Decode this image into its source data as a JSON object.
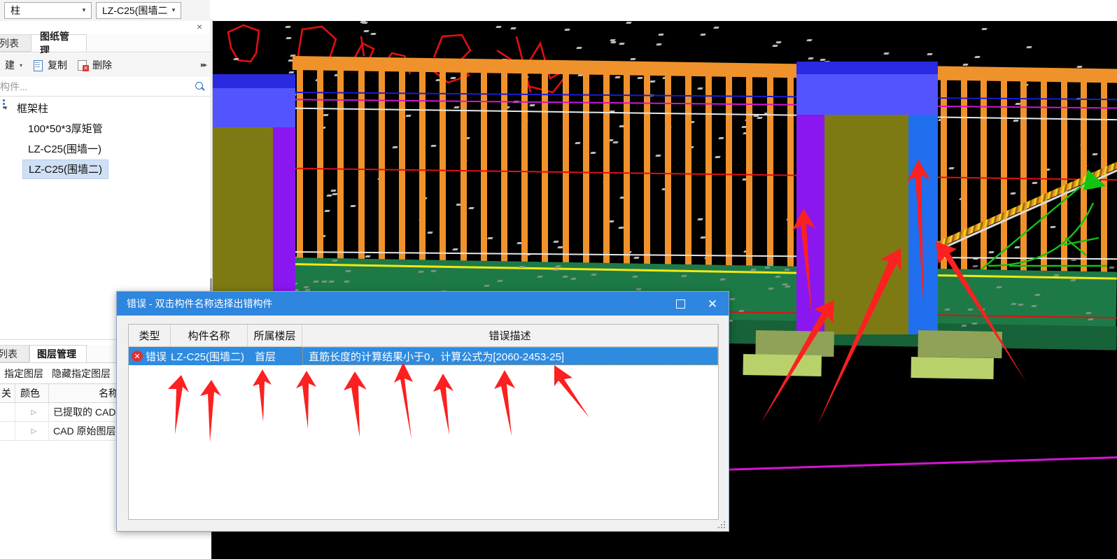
{
  "app": {
    "combos": [
      {
        "name": "category",
        "value": "柱",
        "icon": "chevron-down-icon"
      },
      {
        "name": "member",
        "value": "LZ-C25(围墙二)",
        "icon": "chevron-down-icon"
      }
    ]
  },
  "left_panel": {
    "close_icon": "×",
    "tabs": [
      {
        "label": "列表",
        "active": false
      },
      {
        "label": "图纸管理",
        "active": true
      }
    ],
    "toolbar": {
      "new_label": "建",
      "new_caret": "▾",
      "copy_label": "复制",
      "delete_label": "删除",
      "overflow": "▸▸"
    },
    "search": {
      "placeholder": "构件...",
      "value": "",
      "icon": "search-icon"
    },
    "tree": [
      {
        "label": "框架柱",
        "level": 1,
        "selected": false,
        "expander": "▾"
      },
      {
        "label": "100*50*3厚矩管",
        "level": 2,
        "selected": false
      },
      {
        "label": "LZ-C25(围墙一)",
        "level": 2,
        "selected": false
      },
      {
        "label": "LZ-C25(围墙二)",
        "level": 2,
        "selected": true
      }
    ]
  },
  "layer_panel": {
    "tabs": [
      {
        "label": "列表",
        "active": false
      },
      {
        "label": "图层管理",
        "active": true
      }
    ],
    "buttons": [
      "指定图层",
      "隐藏指定图层"
    ],
    "columns": [
      "关",
      "颜色",
      "名称"
    ],
    "rows": [
      {
        "toggle": "",
        "color": "▷",
        "name": "已提取的 CAD"
      },
      {
        "toggle": "",
        "color": "▷",
        "name": "CAD 原始图层"
      }
    ]
  },
  "dialog": {
    "title": "错误 - 双击构件名称选择出错构件",
    "title_bar_color": "#2e86de",
    "buttons": [
      {
        "name": "maximize",
        "icon": "maximize-icon"
      },
      {
        "name": "close",
        "icon": "close-icon"
      }
    ],
    "columns": [
      "类型",
      "构件名称",
      "所属楼层",
      "错误描述"
    ],
    "rows": [
      {
        "icon": "error-icon",
        "type": "错误",
        "component_name": "LZ-C25(围墙二)",
        "floor": "首层",
        "description": "直筋长度的计算结果小于0，计算公式为[2060-2453-25]",
        "selected": true,
        "selection_color": "#2e8be0"
      }
    ],
    "resize_grip": "resize-grip-icon"
  },
  "viewport": {
    "name": "3d-model-viewport",
    "background": "#000000",
    "colors": {
      "rail": "#f0922b",
      "column_top": "#2a2ae0",
      "column_light_blue": "#5454ff",
      "column_purple": "#8a17f0",
      "column_olive": "#7d7a14",
      "column_blue_face": "#1f6fee",
      "ground": "#1d7a46",
      "footing": "#b9d16a",
      "cad_red": "#e01010",
      "cad_yellow": "#f2e817",
      "cad_green": "#13c413",
      "cad_white": "#e8e8e8",
      "cad_magenta": "#d414d4"
    },
    "annotation_arrows": {
      "color": "#fc2020",
      "count_below_row": 9,
      "count_in_model": 5
    }
  }
}
